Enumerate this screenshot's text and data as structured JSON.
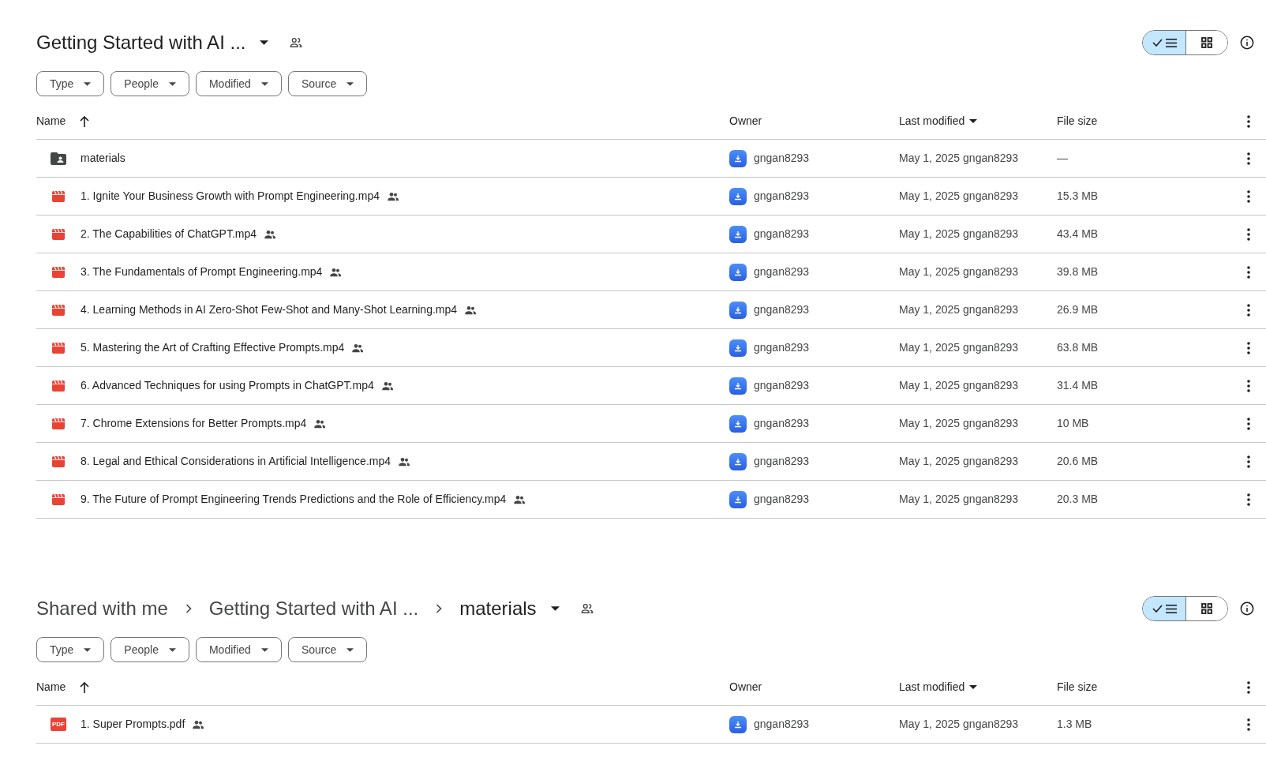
{
  "panels": [
    {
      "breadcrumb": [
        {
          "label": "Getting Started with AI ...",
          "current": true
        }
      ],
      "view_toggle": {
        "list_selected": true
      },
      "filters": [
        "Type",
        "People",
        "Modified",
        "Source"
      ],
      "columns": {
        "name": "Name",
        "owner": "Owner",
        "modified": "Last modified",
        "size": "File size"
      },
      "rows": [
        {
          "kind": "folder",
          "name": "materials",
          "shared": false,
          "owner": "gngan8293",
          "modified": "May 1, 2025",
          "modified_by": "gngan8293",
          "size": "—"
        },
        {
          "kind": "video",
          "name": "1. Ignite Your Business Growth with Prompt Engineering.mp4",
          "shared": true,
          "owner": "gngan8293",
          "modified": "May 1, 2025",
          "modified_by": "gngan8293",
          "size": "15.3 MB"
        },
        {
          "kind": "video",
          "name": "2. The Capabilities of ChatGPT.mp4",
          "shared": true,
          "owner": "gngan8293",
          "modified": "May 1, 2025",
          "modified_by": "gngan8293",
          "size": "43.4 MB"
        },
        {
          "kind": "video",
          "name": "3. The Fundamentals of Prompt Engineering.mp4",
          "shared": true,
          "owner": "gngan8293",
          "modified": "May 1, 2025",
          "modified_by": "gngan8293",
          "size": "39.8 MB"
        },
        {
          "kind": "video",
          "name": "4. Learning Methods in AI Zero-Shot Few-Shot and Many-Shot Learning.mp4",
          "shared": true,
          "owner": "gngan8293",
          "modified": "May 1, 2025",
          "modified_by": "gngan8293",
          "size": "26.9 MB"
        },
        {
          "kind": "video",
          "name": "5. Mastering the Art of Crafting Effective Prompts.mp4",
          "shared": true,
          "owner": "gngan8293",
          "modified": "May 1, 2025",
          "modified_by": "gngan8293",
          "size": "63.8 MB"
        },
        {
          "kind": "video",
          "name": "6. Advanced Techniques for using Prompts in ChatGPT.mp4",
          "shared": true,
          "owner": "gngan8293",
          "modified": "May 1, 2025",
          "modified_by": "gngan8293",
          "size": "31.4 MB"
        },
        {
          "kind": "video",
          "name": "7. Chrome Extensions for Better Prompts.mp4",
          "shared": true,
          "owner": "gngan8293",
          "modified": "May 1, 2025",
          "modified_by": "gngan8293",
          "size": "10 MB"
        },
        {
          "kind": "video",
          "name": "8. Legal and Ethical Considerations in Artificial Intelligence.mp4",
          "shared": true,
          "owner": "gngan8293",
          "modified": "May 1, 2025",
          "modified_by": "gngan8293",
          "size": "20.6 MB"
        },
        {
          "kind": "video",
          "name": "9. The Future of Prompt Engineering Trends Predictions and the Role of Efficiency.mp4",
          "shared": true,
          "owner": "gngan8293",
          "modified": "May 1, 2025",
          "modified_by": "gngan8293",
          "size": "20.3 MB"
        }
      ]
    },
    {
      "breadcrumb": [
        {
          "label": "Shared with me",
          "current": false
        },
        {
          "label": "Getting Started with AI ...",
          "current": false
        },
        {
          "label": "materials",
          "current": true
        }
      ],
      "view_toggle": {
        "list_selected": true
      },
      "filters": [
        "Type",
        "People",
        "Modified",
        "Source"
      ],
      "columns": {
        "name": "Name",
        "owner": "Owner",
        "modified": "Last modified",
        "size": "File size"
      },
      "rows": [
        {
          "kind": "pdf",
          "icon_text": "PDF",
          "name": "1. Super Prompts.pdf",
          "shared": true,
          "owner": "gngan8293",
          "modified": "May 1, 2025",
          "modified_by": "gngan8293",
          "size": "1.3 MB"
        }
      ]
    }
  ]
}
